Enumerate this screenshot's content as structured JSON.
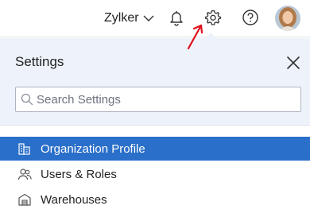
{
  "header": {
    "org_name": "Zylker",
    "icons": [
      "bell-icon",
      "gear-icon",
      "help-icon",
      "avatar"
    ]
  },
  "settings_panel": {
    "title": "Settings",
    "search": {
      "placeholder": "Search Settings",
      "value": ""
    },
    "items": [
      {
        "label": "Organization Profile",
        "icon": "building-icon",
        "active": true
      },
      {
        "label": "Users & Roles",
        "icon": "users-icon",
        "active": false
      },
      {
        "label": "Warehouses",
        "icon": "warehouse-icon",
        "active": false
      }
    ]
  },
  "colors": {
    "accent": "#2a6fc9",
    "panel_bg": "#eef2fa",
    "annotation_arrow": "#e0101a"
  }
}
